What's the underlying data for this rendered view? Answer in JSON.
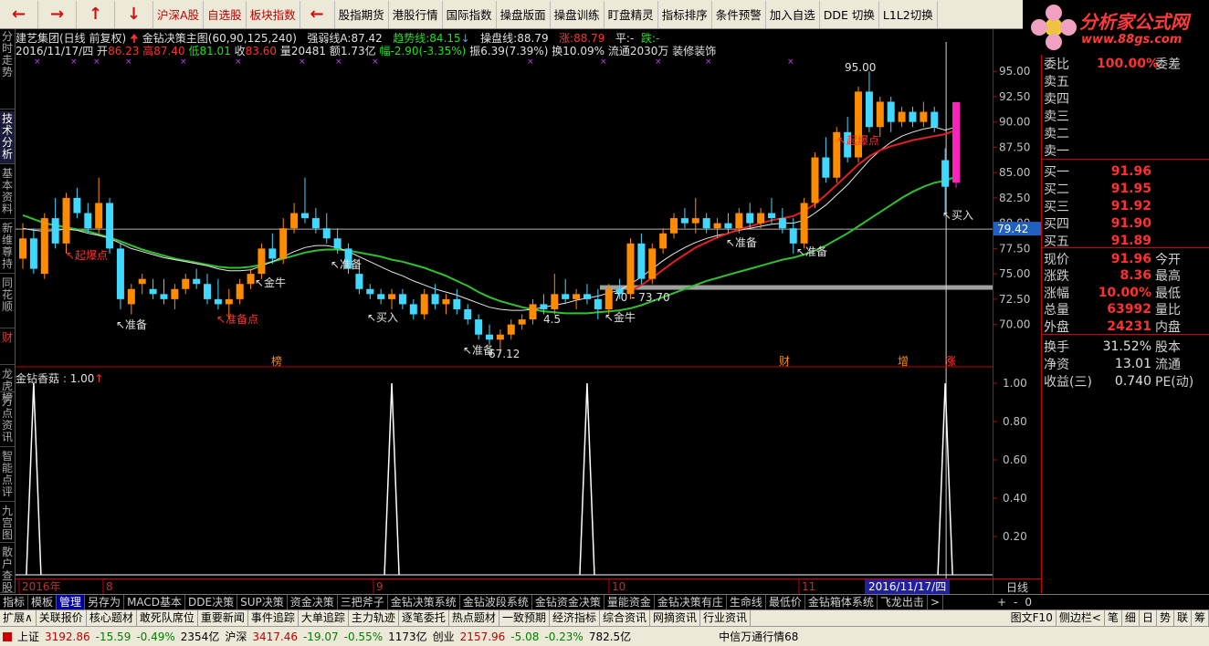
{
  "toolbar": {
    "nav": [
      "←",
      "→",
      "↑",
      "↓"
    ],
    "buttons": [
      {
        "label": "沪深A股",
        "red": true
      },
      {
        "label": "自选股",
        "red": true
      },
      {
        "label": "板块指数",
        "red": true
      },
      {
        "label": "股指期货",
        "red": false
      },
      {
        "label": "港股行情",
        "red": false
      },
      {
        "label": "国际指数",
        "red": false
      },
      {
        "label": "操盘版面",
        "red": false
      },
      {
        "label": "操盘训练",
        "red": false
      },
      {
        "label": "盯盘精灵",
        "red": false
      },
      {
        "label": "指标排序",
        "red": false
      },
      {
        "label": "条件预警",
        "red": false
      },
      {
        "label": "加入自选",
        "red": false
      },
      {
        "label": "DDE 切换",
        "red": false
      },
      {
        "label": "L1L2切换",
        "red": false
      }
    ],
    "logo_text": "分析家公式网",
    "logo_url": "www.88gs.com"
  },
  "left_tabs": [
    "分时走势",
    "技术分析",
    "基本资料",
    "新维尊持",
    "同花顺",
    "财",
    "龙虎榜",
    "万点资讯",
    "智能点评",
    "九宫图",
    "散户查股"
  ],
  "header": {
    "line1": {
      "stock": "建艺集团(日线 前复权)",
      "formula": "金钻决策主图(60,90,125,240)",
      "qrx_label": "强弱线A:",
      "qrx": "87.42",
      "qsx_label": "趋势线:",
      "qsx": "84.15",
      "cpx_label": "操盘线:",
      "cpx": "88.79",
      "zhang_label": "涨:",
      "zhang": "88.79",
      "ping_label": "平:",
      "ping": "-",
      "die_label": "跌:",
      "die": "-"
    },
    "line2": {
      "date": "2016/11/17/四",
      "open_label": "开",
      "open": "86.23",
      "high_label": "高",
      "high": "87.40",
      "low_label": "低",
      "low": "81.01",
      "close_label": "收",
      "close": "83.60",
      "vol_label": "量",
      "vol": "20481",
      "amt_label": "额",
      "amt": "1.73亿",
      "fu_label": "幅",
      "fu": "-2.90(-3.35%)",
      "zf": "振6.39(7.39%)",
      "hs": "换10.09%",
      "lt": "流通2030万",
      "hy": "装修装饰"
    }
  },
  "sub_header": {
    "name": "金钻香菇",
    "value": "1.00"
  },
  "chart_data": {
    "type": "candlestick",
    "title": "建艺集团(日线 前复权)",
    "ylim": [
      66,
      97
    ],
    "y_ticks": [
      "95.00",
      "92.50",
      "90.00",
      "87.50",
      "85.00",
      "82.50",
      "80.00",
      "77.50",
      "75.00",
      "72.50",
      "70.00"
    ],
    "current_price_tag": "79.42",
    "month_labels": [
      "2016年",
      "8",
      "9",
      "10",
      "11"
    ],
    "current_date": "2016/11/17/四",
    "candles": [
      {
        "o": 76.5,
        "h": 80.0,
        "l": 75.5,
        "c": 78.5
      },
      {
        "o": 78.5,
        "h": 79.5,
        "l": 75.0,
        "c": 75.5
      },
      {
        "o": 75.0,
        "h": 81.0,
        "l": 74.5,
        "c": 80.5
      },
      {
        "o": 80.5,
        "h": 82.5,
        "l": 77.5,
        "c": 78.0
      },
      {
        "o": 78.0,
        "h": 83.0,
        "l": 77.0,
        "c": 82.5
      },
      {
        "o": 82.5,
        "h": 83.5,
        "l": 80.5,
        "c": 81.0
      },
      {
        "o": 81.0,
        "h": 82.0,
        "l": 79.0,
        "c": 79.5
      },
      {
        "o": 79.5,
        "h": 84.5,
        "l": 79.0,
        "c": 82.0
      },
      {
        "o": 82.0,
        "h": 82.5,
        "l": 77.0,
        "c": 77.5
      },
      {
        "o": 77.5,
        "h": 78.0,
        "l": 71.5,
        "c": 72.5
      },
      {
        "o": 72.0,
        "h": 74.0,
        "l": 71.0,
        "c": 73.5
      },
      {
        "o": 74.0,
        "h": 75.0,
        "l": 73.0,
        "c": 74.5
      },
      {
        "o": 73.5,
        "h": 74.5,
        "l": 72.5,
        "c": 73.0
      },
      {
        "o": 73.0,
        "h": 74.5,
        "l": 72.0,
        "c": 72.5
      },
      {
        "o": 72.5,
        "h": 74.0,
        "l": 71.5,
        "c": 73.5
      },
      {
        "o": 73.5,
        "h": 75.0,
        "l": 73.0,
        "c": 74.5
      },
      {
        "o": 74.5,
        "h": 75.5,
        "l": 73.5,
        "c": 74.0
      },
      {
        "o": 74.0,
        "h": 75.0,
        "l": 72.0,
        "c": 72.5
      },
      {
        "o": 72.5,
        "h": 74.5,
        "l": 71.5,
        "c": 72.0
      },
      {
        "o": 72.0,
        "h": 73.5,
        "l": 70.5,
        "c": 72.5
      },
      {
        "o": 72.5,
        "h": 74.5,
        "l": 72.0,
        "c": 74.0
      },
      {
        "o": 74.0,
        "h": 75.5,
        "l": 73.5,
        "c": 75.0
      },
      {
        "o": 75.0,
        "h": 78.0,
        "l": 74.5,
        "c": 77.5
      },
      {
        "o": 77.5,
        "h": 79.0,
        "l": 76.0,
        "c": 76.5
      },
      {
        "o": 76.5,
        "h": 80.5,
        "l": 76.0,
        "c": 79.5
      },
      {
        "o": 79.5,
        "h": 82.0,
        "l": 79.0,
        "c": 81.0
      },
      {
        "o": 81.0,
        "h": 84.5,
        "l": 80.0,
        "c": 80.5
      },
      {
        "o": 80.5,
        "h": 81.5,
        "l": 79.0,
        "c": 79.5
      },
      {
        "o": 79.5,
        "h": 81.0,
        "l": 78.0,
        "c": 78.5
      },
      {
        "o": 78.5,
        "h": 79.5,
        "l": 77.0,
        "c": 77.5
      },
      {
        "o": 77.5,
        "h": 78.0,
        "l": 75.0,
        "c": 75.5
      },
      {
        "o": 75.0,
        "h": 76.5,
        "l": 73.0,
        "c": 73.5
      },
      {
        "o": 73.5,
        "h": 74.0,
        "l": 72.5,
        "c": 73.0
      },
      {
        "o": 73.0,
        "h": 73.5,
        "l": 72.0,
        "c": 72.5
      },
      {
        "o": 72.5,
        "h": 73.5,
        "l": 71.5,
        "c": 73.0
      },
      {
        "o": 73.0,
        "h": 73.5,
        "l": 71.5,
        "c": 72.0
      },
      {
        "o": 72.0,
        "h": 72.5,
        "l": 70.5,
        "c": 71.0
      },
      {
        "o": 71.0,
        "h": 73.5,
        "l": 70.5,
        "c": 73.0
      },
      {
        "o": 73.0,
        "h": 74.0,
        "l": 71.5,
        "c": 72.0
      },
      {
        "o": 72.0,
        "h": 73.0,
        "l": 71.0,
        "c": 72.5
      },
      {
        "o": 72.5,
        "h": 73.5,
        "l": 71.0,
        "c": 71.5
      },
      {
        "o": 71.5,
        "h": 72.0,
        "l": 70.0,
        "c": 70.5
      },
      {
        "o": 70.5,
        "h": 71.0,
        "l": 68.5,
        "c": 69.0
      },
      {
        "o": 69.0,
        "h": 70.0,
        "l": 68.0,
        "c": 68.5
      },
      {
        "o": 68.5,
        "h": 69.5,
        "l": 67.1,
        "c": 69.0
      },
      {
        "o": 69.0,
        "h": 70.5,
        "l": 68.5,
        "c": 70.0
      },
      {
        "o": 70.0,
        "h": 71.0,
        "l": 69.5,
        "c": 70.5
      },
      {
        "o": 70.5,
        "h": 72.5,
        "l": 70.0,
        "c": 72.0
      },
      {
        "o": 72.0,
        "h": 73.0,
        "l": 71.0,
        "c": 71.5
      },
      {
        "o": 71.5,
        "h": 75.0,
        "l": 71.0,
        "c": 73.0
      },
      {
        "o": 73.0,
        "h": 74.5,
        "l": 72.0,
        "c": 72.5
      },
      {
        "o": 72.5,
        "h": 73.5,
        "l": 71.5,
        "c": 73.0
      },
      {
        "o": 73.0,
        "h": 74.0,
        "l": 72.0,
        "c": 72.5
      },
      {
        "o": 72.5,
        "h": 73.5,
        "l": 70.5,
        "c": 71.5
      },
      {
        "o": 71.5,
        "h": 74.0,
        "l": 71.0,
        "c": 73.5
      },
      {
        "o": 73.5,
        "h": 74.5,
        "l": 72.5,
        "c": 73.0
      },
      {
        "o": 73.0,
        "h": 78.5,
        "l": 72.5,
        "c": 78.0
      },
      {
        "o": 78.0,
        "h": 79.0,
        "l": 74.0,
        "c": 74.5
      },
      {
        "o": 74.5,
        "h": 78.0,
        "l": 74.0,
        "c": 77.5
      },
      {
        "o": 77.5,
        "h": 79.5,
        "l": 77.0,
        "c": 79.0
      },
      {
        "o": 79.0,
        "h": 81.0,
        "l": 78.5,
        "c": 80.5
      },
      {
        "o": 80.5,
        "h": 81.5,
        "l": 79.5,
        "c": 80.0
      },
      {
        "o": 80.0,
        "h": 82.5,
        "l": 79.0,
        "c": 80.5
      },
      {
        "o": 80.5,
        "h": 81.0,
        "l": 79.0,
        "c": 79.5
      },
      {
        "o": 79.5,
        "h": 80.5,
        "l": 78.5,
        "c": 80.0
      },
      {
        "o": 80.0,
        "h": 81.0,
        "l": 79.0,
        "c": 79.5
      },
      {
        "o": 79.5,
        "h": 81.5,
        "l": 79.0,
        "c": 81.0
      },
      {
        "o": 81.0,
        "h": 82.0,
        "l": 79.5,
        "c": 80.0
      },
      {
        "o": 80.0,
        "h": 81.5,
        "l": 79.5,
        "c": 81.0
      },
      {
        "o": 81.0,
        "h": 82.5,
        "l": 80.0,
        "c": 80.5
      },
      {
        "o": 80.5,
        "h": 81.5,
        "l": 79.0,
        "c": 79.5
      },
      {
        "o": 79.5,
        "h": 80.5,
        "l": 77.0,
        "c": 78.0
      },
      {
        "o": 78.0,
        "h": 82.5,
        "l": 77.5,
        "c": 82.0
      },
      {
        "o": 82.0,
        "h": 87.0,
        "l": 81.5,
        "c": 86.5
      },
      {
        "o": 86.5,
        "h": 88.5,
        "l": 84.0,
        "c": 84.5
      },
      {
        "o": 84.5,
        "h": 89.5,
        "l": 84.0,
        "c": 89.0
      },
      {
        "o": 89.0,
        "h": 90.5,
        "l": 86.0,
        "c": 86.5
      },
      {
        "o": 86.5,
        "h": 93.5,
        "l": 86.0,
        "c": 93.0
      },
      {
        "o": 93.0,
        "h": 95.0,
        "l": 89.0,
        "c": 89.5
      },
      {
        "o": 89.5,
        "h": 92.5,
        "l": 88.5,
        "c": 92.0
      },
      {
        "o": 92.0,
        "h": 92.5,
        "l": 89.0,
        "c": 90.0
      },
      {
        "o": 90.0,
        "h": 91.5,
        "l": 89.5,
        "c": 91.0
      },
      {
        "o": 91.0,
        "h": 91.5,
        "l": 89.5,
        "c": 90.0
      },
      {
        "o": 90.0,
        "h": 92.0,
        "l": 89.5,
        "c": 91.0
      },
      {
        "o": 91.0,
        "h": 91.5,
        "l": 89.0,
        "c": 89.5
      },
      {
        "o": 86.23,
        "h": 87.4,
        "l": 81.01,
        "c": 83.6
      },
      {
        "o": 84.0,
        "h": 91.96,
        "l": 83.5,
        "c": 91.96
      }
    ],
    "ma_white": [
      79.5,
      79.3,
      79.2,
      79.3,
      79.4,
      79.3,
      79.0,
      78.8,
      78.5,
      78.0,
      77.5,
      77.2,
      76.9,
      76.6,
      76.4,
      76.2,
      76.0,
      75.8,
      75.5,
      75.3,
      75.3,
      75.4,
      75.8,
      76.2,
      76.7,
      77.2,
      77.6,
      77.8,
      77.8,
      77.6,
      77.2,
      76.7,
      76.2,
      75.7,
      75.2,
      74.8,
      74.3,
      73.9,
      73.5,
      73.2,
      72.9,
      72.5,
      72.1,
      71.7,
      71.5,
      71.4,
      71.4,
      71.5,
      71.7,
      71.9,
      72.1,
      72.4,
      72.6,
      72.8,
      73.1,
      73.4,
      74.0,
      74.7,
      75.5,
      76.3,
      77.0,
      77.6,
      78.1,
      78.5,
      78.8,
      79.0,
      79.3,
      79.5,
      79.7,
      79.9,
      80.0,
      80.0,
      80.3,
      81.0,
      81.8,
      82.8,
      83.8,
      85.0,
      86.2,
      87.2,
      88.0,
      88.6,
      89.0,
      89.3,
      89.5,
      89.2,
      89.5
    ],
    "ma_red": [
      null,
      null,
      null,
      null,
      null,
      null,
      null,
      null,
      null,
      null,
      null,
      null,
      null,
      null,
      null,
      null,
      null,
      null,
      null,
      null,
      null,
      null,
      null,
      null,
      null,
      null,
      null,
      null,
      null,
      null,
      null,
      null,
      null,
      null,
      null,
      null,
      null,
      null,
      null,
      null,
      null,
      null,
      null,
      null,
      null,
      null,
      null,
      null,
      null,
      null,
      null,
      null,
      null,
      null,
      null,
      null,
      73.3,
      73.9,
      74.6,
      75.4,
      76.2,
      76.9,
      77.6,
      78.1,
      78.6,
      79.0,
      79.4,
      79.7,
      80.0,
      80.3,
      80.5,
      80.7,
      81.2,
      81.9,
      82.8,
      83.8,
      84.8,
      85.8,
      86.6,
      87.2,
      87.6,
      87.9,
      88.2,
      88.4,
      88.6,
      88.8,
      89.2
    ],
    "ma_green": [
      80.8,
      80.4,
      80.0,
      79.8,
      79.6,
      79.4,
      79.2,
      78.9,
      78.6,
      78.2,
      77.8,
      77.4,
      77.1,
      76.8,
      76.5,
      76.3,
      76.1,
      75.9,
      75.7,
      75.6,
      75.6,
      75.7,
      75.9,
      76.2,
      76.5,
      76.8,
      77.1,
      77.3,
      77.4,
      77.4,
      77.3,
      77.1,
      76.9,
      76.7,
      76.4,
      76.2,
      75.9,
      75.6,
      75.2,
      74.8,
      74.3,
      73.8,
      73.2,
      72.7,
      72.3,
      72.0,
      71.7,
      71.5,
      71.3,
      71.2,
      71.1,
      71.1,
      71.1,
      71.2,
      71.3,
      71.4,
      71.6,
      71.9,
      72.3,
      72.7,
      73.1,
      73.5,
      73.9,
      74.3,
      74.6,
      74.9,
      75.2,
      75.5,
      75.8,
      76.1,
      76.4,
      76.6,
      76.9,
      77.3,
      77.8,
      78.4,
      79.0,
      79.7,
      80.4,
      81.1,
      81.8,
      82.5,
      83.1,
      83.6,
      84.0,
      84.2,
      84.6
    ],
    "annotations": [
      "起爆点",
      "准备",
      "准备点",
      "金牛",
      "准备",
      "买入",
      "准备",
      "买入",
      "准备",
      "起爆点",
      "准备",
      "金牛",
      "95.00",
      "67.12",
      "70 - 73.70",
      "4.5",
      "榜",
      "财",
      "增",
      "涨"
    ],
    "sub_chart": {
      "name": "金钻香菇",
      "ylim": [
        0,
        1
      ],
      "y_ticks": [
        "1.00",
        "0.80",
        "0.60",
        "0.40",
        "0.20"
      ],
      "spikes_at_index": [
        1,
        34,
        52,
        85
      ]
    }
  },
  "order_book": {
    "header": {
      "label": "委比",
      "value": "100.00%",
      "label2": "委差"
    },
    "asks": [
      {
        "label": "卖五"
      },
      {
        "label": "卖四"
      },
      {
        "label": "卖三"
      },
      {
        "label": "卖二"
      },
      {
        "label": "卖一"
      }
    ],
    "bids": [
      {
        "label": "买一",
        "price": "91.96"
      },
      {
        "label": "买二",
        "price": "91.95"
      },
      {
        "label": "买三",
        "price": "91.92"
      },
      {
        "label": "买四",
        "price": "91.90"
      },
      {
        "label": "买五",
        "price": "91.89"
      }
    ]
  },
  "quote": [
    {
      "l1": "现价",
      "v1": "91.96",
      "l2": "今开"
    },
    {
      "l1": "涨跌",
      "v1": "8.36",
      "l2": "最高"
    },
    {
      "l1": "涨幅",
      "v1": "10.00%",
      "l2": "最低"
    },
    {
      "l1": "总量",
      "v1": "63992",
      "l2": "量比"
    },
    {
      "l1": "外盘",
      "v1": "24231",
      "l2": "内盘"
    }
  ],
  "fundamentals": [
    {
      "l1": "换手",
      "v1": "31.52%",
      "l2": "股本"
    },
    {
      "l1": "净资",
      "v1": "13.01",
      "l2": "流通"
    },
    {
      "l1": "收益(三)",
      "v1": "0.740",
      "l2": "PE(动)"
    }
  ],
  "bottom_tabs": [
    "指标",
    "模板",
    "管理",
    "另存为",
    "MACD基本",
    "DDE决策",
    "SUP决策",
    "资金决策",
    "三把斧子",
    "金钻决策系统",
    "金钻波段系统",
    "金钻资金决策",
    "量能资金",
    "金钻决策有庄",
    "生命线",
    "最低价",
    "金钻箱体系统",
    "飞龙出击",
    ">"
  ],
  "bottom_tabs_active": "管理",
  "period_label": "日线",
  "period_controls": [
    "+",
    "-",
    "0"
  ],
  "bottom_tabs2": [
    "扩展∧",
    "关联报价",
    "核心题材",
    "敢死队席位",
    "重要新闻",
    "事件追踪",
    "大单追踪",
    "主力轨迹",
    "逐笔委托",
    "热点题材",
    "一致预期",
    "经济指标",
    "综合资讯",
    "网摘资讯",
    "行业资讯"
  ],
  "bottom_tabs2_right": [
    "图文F10",
    "侧边栏<",
    "笔",
    "细",
    "日",
    "势",
    "联",
    "筹"
  ],
  "status": {
    "sh_label": "上证",
    "sh_val": "3192.86",
    "sh_chg": "-15.59",
    "sh_pct": "-0.49%",
    "sh_amt": "2354亿",
    "hs_label": "沪深",
    "hs_val": "3417.46",
    "hs_chg": "-19.07",
    "hs_pct": "-0.55%",
    "hs_amt": "1173亿",
    "cy_label": "创业",
    "cy_val": "2157.96",
    "cy_chg": "-5.08",
    "cy_pct": "-0.23%",
    "cy_amt": "782.5亿",
    "broker": "中信万通行情68"
  }
}
